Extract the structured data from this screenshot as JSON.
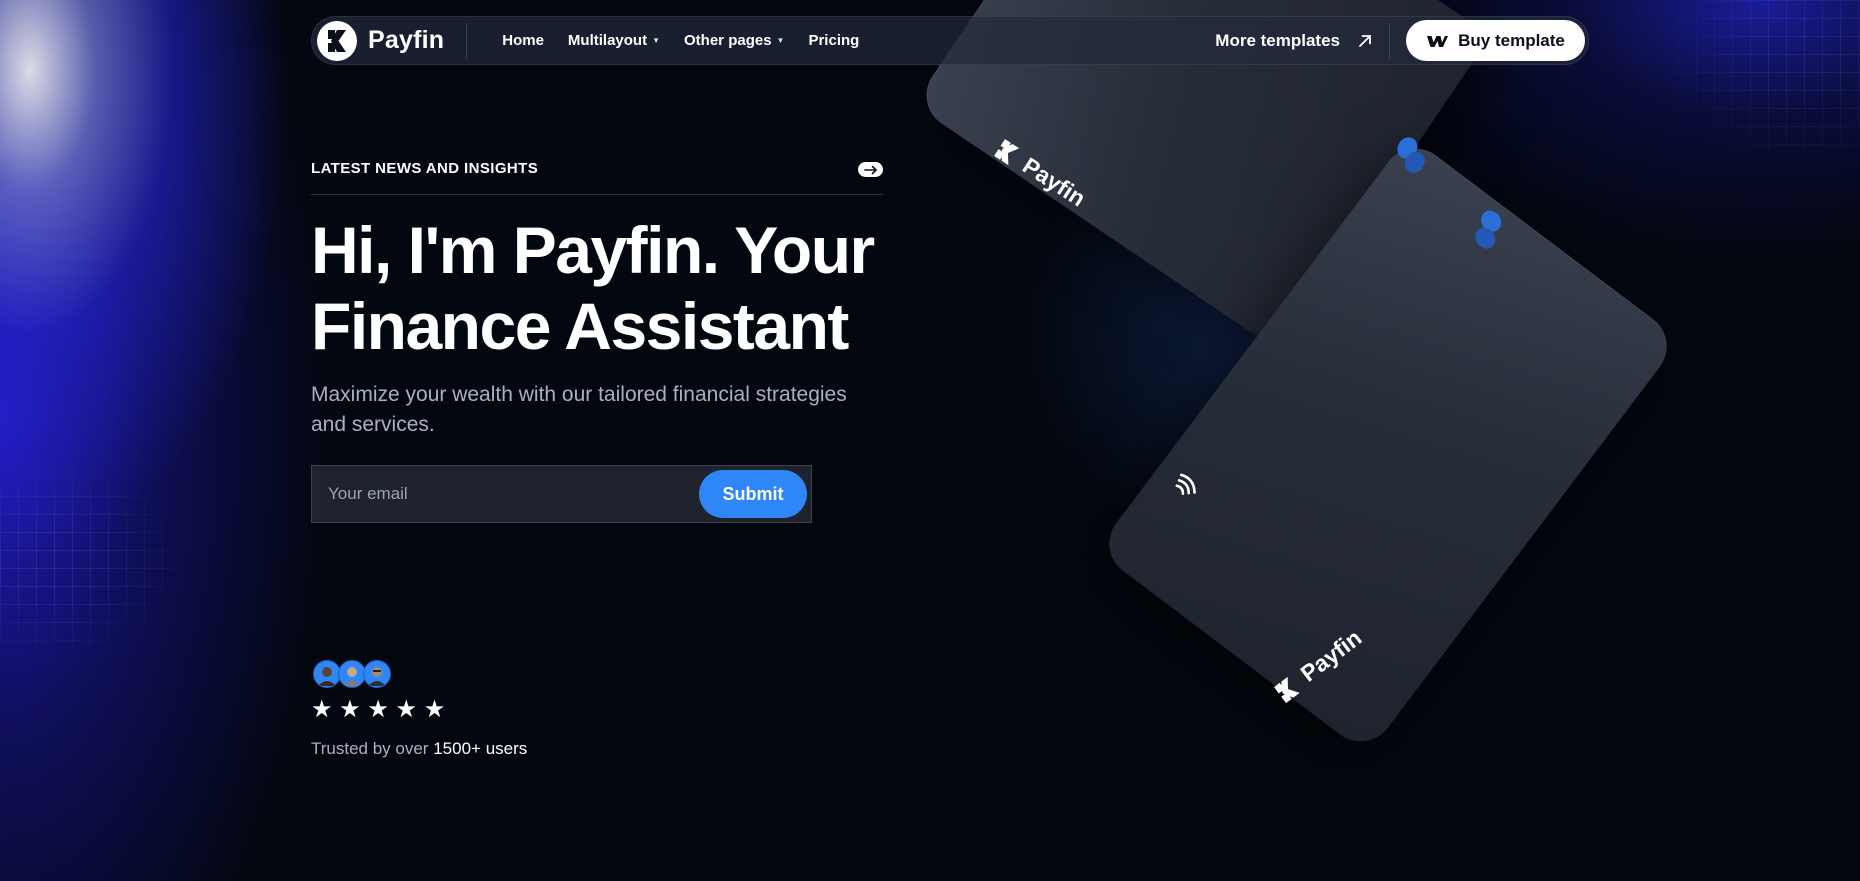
{
  "nav": {
    "brand_name": "Payfin",
    "links": [
      {
        "label": "Home",
        "has_caret": false
      },
      {
        "label": "Multilayout",
        "has_caret": true
      },
      {
        "label": "Other pages",
        "has_caret": true
      },
      {
        "label": "Pricing",
        "has_caret": false
      }
    ],
    "more_templates_label": "More templates",
    "buy_template_label": "Buy template"
  },
  "hero": {
    "eyebrow": "LATEST NEWS AND INSIGHTS",
    "headline": "Hi, I'm Payfin. Your Finance Assistant",
    "subtext": "Maximize your wealth with our tailored financial strategies and services.",
    "email_placeholder": "Your email",
    "submit_label": "Submit",
    "rating_stars": 5,
    "stars_text": "★ ★ ★ ★ ★",
    "trusted_prefix": "Trusted by over",
    "trusted_count": "1500+ users"
  },
  "cards": {
    "back_label": "Payfin",
    "front_label": "Payfin"
  },
  "colors": {
    "accent": "#2e86f7",
    "background": "#03070f",
    "card": "#272d39",
    "glow": "#2820dc"
  },
  "icons": {
    "brand": "payfin-logo-icon",
    "caret": "caret-down-icon",
    "more_templates": "arrow-up-right-icon",
    "buy_template": "webflow-icon",
    "eyebrow": "arrow-right-icon",
    "contactless": "contactless-icon"
  }
}
